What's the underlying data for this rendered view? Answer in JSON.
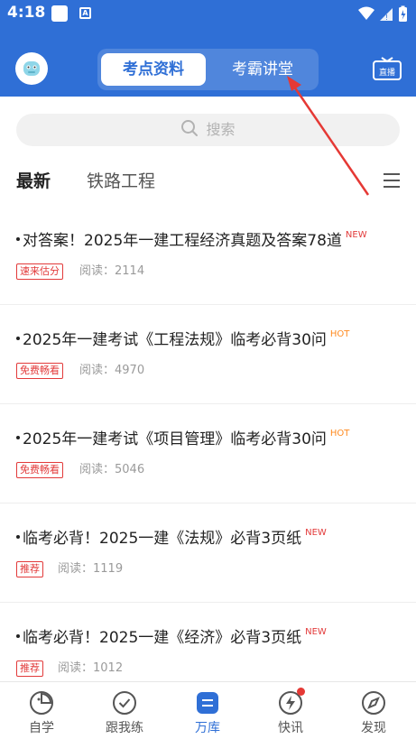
{
  "status_bar": {
    "time": "4:18",
    "icon2_glyph": "A"
  },
  "header": {
    "tabs": [
      {
        "label": "考点资料",
        "active": true
      },
      {
        "label": "考霸讲堂",
        "active": false
      }
    ],
    "tv_label": "直播"
  },
  "search": {
    "placeholder": "搜索"
  },
  "categories": {
    "active": "最新",
    "other": "铁路工程"
  },
  "articles": [
    {
      "title": "对答案！2025年一建工程经济真题及答案78道",
      "badge": "NEW",
      "tag": "速来估分",
      "reads_label": "阅读：",
      "reads": "2114"
    },
    {
      "title": "2025年一建考试《工程法规》临考必背30问",
      "badge": "HOT",
      "tag": "免费畅看",
      "reads_label": "阅读：",
      "reads": "4970"
    },
    {
      "title": "2025年一建考试《项目管理》临考必背30问",
      "badge": "HOT",
      "tag": "免费畅看",
      "reads_label": "阅读：",
      "reads": "5046"
    },
    {
      "title": "临考必背！2025一建《法规》必背3页纸",
      "badge": "NEW",
      "tag": "推荐",
      "reads_label": "阅读：",
      "reads": "1119"
    },
    {
      "title": "临考必背！2025一建《经济》必背3页纸",
      "badge": "NEW",
      "tag": "推荐",
      "reads_label": "阅读：",
      "reads": "1012"
    }
  ],
  "bottom_nav": [
    {
      "label": "自学",
      "icon": "self-study-icon"
    },
    {
      "label": "跟我练",
      "icon": "practice-icon"
    },
    {
      "label": "万库",
      "icon": "library-icon",
      "active": true
    },
    {
      "label": "快讯",
      "icon": "news-icon",
      "has_dot": true
    },
    {
      "label": "发现",
      "icon": "discover-icon"
    }
  ],
  "colors": {
    "primary": "#2f6fd6",
    "red": "#e23a3a",
    "orange": "#ff8a1f"
  }
}
